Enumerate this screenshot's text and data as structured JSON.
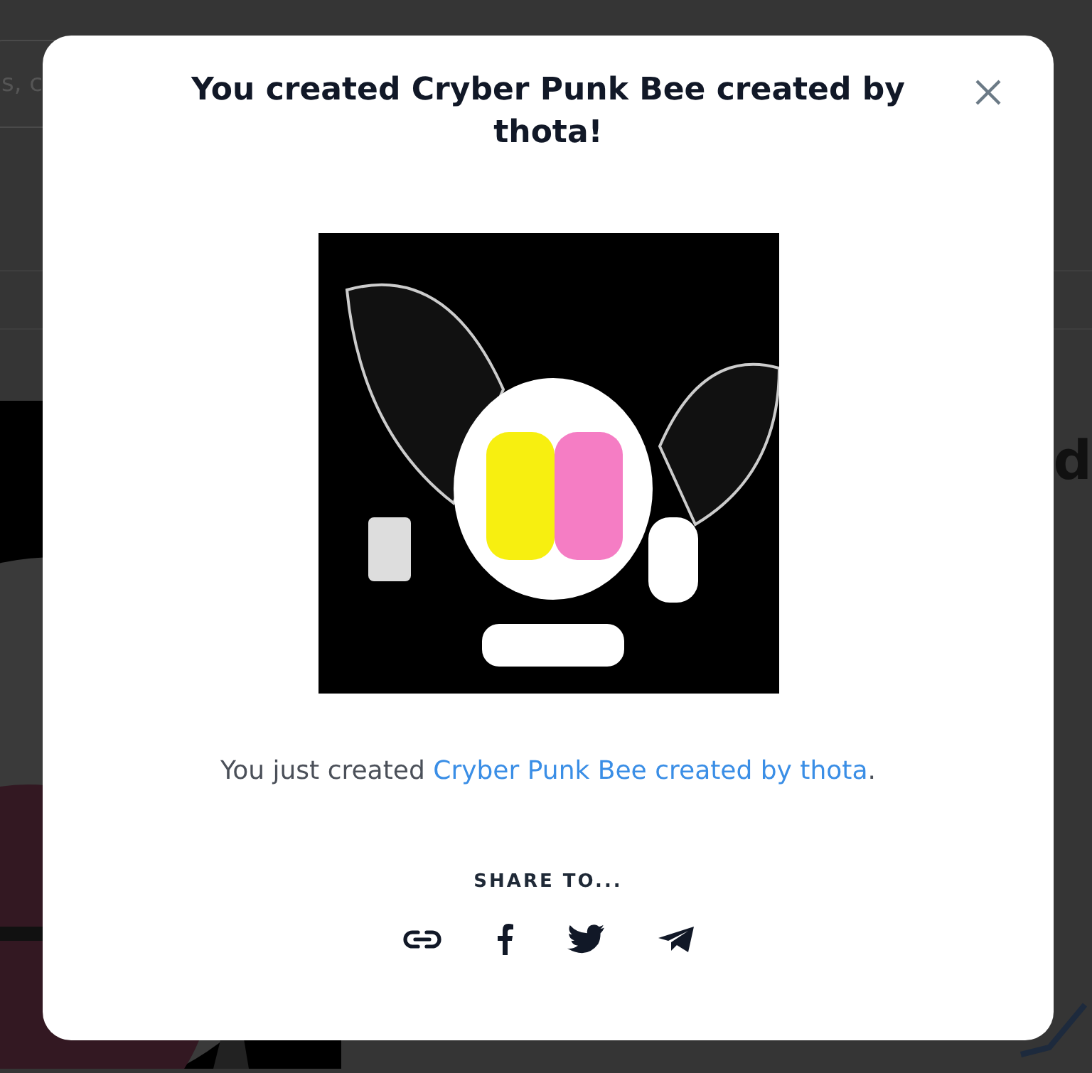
{
  "background": {
    "search_value": "s, c",
    "heading": "d"
  },
  "modal": {
    "title": "You created Cryber Punk Bee created by thota!",
    "message": {
      "text": "You just created ",
      "link": "Cryber Punk Bee created by thota",
      "end": "."
    },
    "share_label": "SHARE TO...",
    "share": [
      {
        "kind": "link"
      },
      {
        "kind": "facebook"
      },
      {
        "kind": "twitter"
      },
      {
        "kind": "telegram"
      }
    ]
  }
}
